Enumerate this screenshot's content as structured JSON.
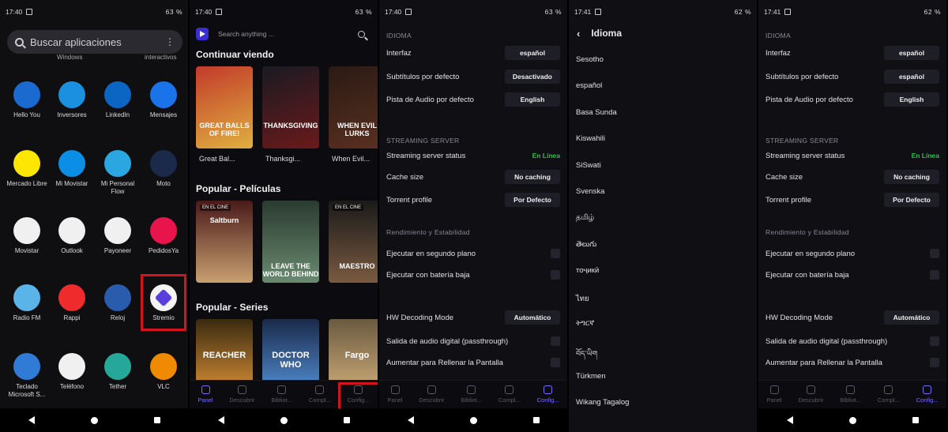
{
  "panel1": {
    "status": {
      "time": "17:40",
      "battery": "63 %"
    },
    "search_placeholder": "Buscar aplicaciones",
    "cut_left": "Windows",
    "cut_right": "interactivos",
    "apps": [
      {
        "label": "Hello You",
        "icon": "hello-you-icon",
        "color": "#1a6ad0"
      },
      {
        "label": "Inversores",
        "icon": "inversores-icon",
        "color": "#1b8fe0"
      },
      {
        "label": "LinkedIn",
        "icon": "linkedin-icon",
        "color": "#0a66c2"
      },
      {
        "label": "Mensajes",
        "icon": "messages-icon",
        "color": "#1a73e8"
      },
      {
        "label": "Mercado Libre",
        "icon": "mercadolibre-icon",
        "color": "#ffe600"
      },
      {
        "label": "Mi Movistar",
        "icon": "movistar-icon",
        "color": "#0b8fe6"
      },
      {
        "label": "Mi Personal Flow",
        "icon": "personal-flow-icon",
        "color": "#2aa7e0"
      },
      {
        "label": "Moto",
        "icon": "moto-icon",
        "color": "#1b2a4a"
      },
      {
        "label": "Movistar",
        "icon": "sim-icon",
        "color": "#f0f0f0"
      },
      {
        "label": "Outlook",
        "icon": "outlook-icon",
        "color": "#f0f0f0"
      },
      {
        "label": "Payoneer",
        "icon": "payoneer-icon",
        "color": "#f0f0f0"
      },
      {
        "label": "PedidosYa",
        "icon": "pedidosya-icon",
        "color": "#e8144c"
      },
      {
        "label": "Radio FM",
        "icon": "radio-icon",
        "color": "#5ab4e8"
      },
      {
        "label": "Rappi",
        "icon": "rappi-icon",
        "color": "#f02b2b"
      },
      {
        "label": "Reloj",
        "icon": "clock-icon",
        "color": "#2a5cae"
      },
      {
        "label": "Stremio",
        "icon": "stremio-icon",
        "color": "#f4f4f4"
      },
      {
        "label": "Teclado Microsoft S...",
        "icon": "keyboard-icon",
        "color": "#2f7bd6"
      },
      {
        "label": "Teléfono",
        "icon": "phone-icon",
        "color": "#f0f0f0"
      },
      {
        "label": "Tether",
        "icon": "tether-icon",
        "color": "#25a89a"
      },
      {
        "label": "VLC",
        "icon": "vlc-icon",
        "color": "#f08a00"
      }
    ]
  },
  "panel2": {
    "status": {
      "time": "17:40",
      "battery": "63 %"
    },
    "search_placeholder": "Search anything ...",
    "sections": [
      "Continuar viendo",
      "Popular - Películas",
      "Popular - Series"
    ],
    "continue": [
      {
        "title": "Great Bal...",
        "art": "GREAT BALLS OF FIRE!"
      },
      {
        "title": "Thanksgi...",
        "art": "THANKSGIVING"
      },
      {
        "title": "When Evil...",
        "art": "WHEN EVIL LURKS"
      }
    ],
    "movies": [
      {
        "badge": "EN EL CINE",
        "art": "Saltburn"
      },
      {
        "badge": "",
        "art": "LEAVE THE WORLD BEHIND"
      },
      {
        "badge": "EN EL CINE",
        "art": "MAESTRO"
      }
    ],
    "series": [
      {
        "art": "REACHER"
      },
      {
        "art": "DOCTOR WHO"
      },
      {
        "art": "Fargo"
      }
    ],
    "tabs": [
      "Panel",
      "Descubrir",
      "Bibliot...",
      "Compl...",
      "Config..."
    ]
  },
  "panel3": {
    "status": {
      "time": "17:40",
      "battery": "63 %"
    },
    "idioma": "IDIOMA",
    "interfaz": {
      "label": "Interfaz",
      "value": "español"
    },
    "subtitulos": {
      "label": "Subtítulos por defecto",
      "value": "Desactivado"
    },
    "audio": {
      "label": "Pista de Audio por defecto",
      "value": "English"
    },
    "streaming": "STREAMING SERVER",
    "server_status": {
      "label": "Streaming server status",
      "value": "En Línea"
    },
    "cache": {
      "label": "Cache size",
      "value": "No caching"
    },
    "torrent": {
      "label": "Torrent profile",
      "value": "Por Defecto"
    },
    "rendimiento": "Rendimiento y Estabilidad",
    "bg": "Ejecutar en segundo plano",
    "lowbat": "Ejecutar con batería baja",
    "hw": {
      "label": "HW Decoding Mode",
      "value": "Automático"
    },
    "passthrough": "Salida de audio digital (passthrough)",
    "fill": "Aumentar para Rellenar la Pantalla",
    "tabs": [
      "Panel",
      "Descubrir",
      "Bibliot...",
      "Compl...",
      "Config..."
    ]
  },
  "panel4": {
    "status": {
      "time": "17:41",
      "battery": "62 %"
    },
    "title": "Idioma",
    "languages": [
      "Sesotho",
      "español",
      "Basa Sunda",
      "Kiswahili",
      "SiSwati",
      "Svenska",
      "தமிழ்",
      "తెలుగు",
      "тоҷикӣ",
      "ไทย",
      "ትግርኛ",
      "བོད་ཡིག",
      "Türkmen",
      "Wikang Tagalog"
    ]
  },
  "panel5": {
    "status": {
      "time": "17:41",
      "battery": "62 %"
    },
    "idioma": "IDIOMA",
    "interfaz": {
      "label": "Interfaz",
      "value": "español"
    },
    "subtitulos": {
      "label": "Subtítulos por defecto",
      "value": "español"
    },
    "audio": {
      "label": "Pista de Audio por defecto",
      "value": "English"
    },
    "streaming": "STREAMING SERVER",
    "server_status": {
      "label": "Streaming server status",
      "value": "En Línea"
    },
    "cache": {
      "label": "Cache size",
      "value": "No caching"
    },
    "torrent": {
      "label": "Torrent profile",
      "value": "Por Defecto"
    },
    "rendimiento": "Rendimiento y Estabilidad",
    "bg": "Ejecutar en segundo plano",
    "lowbat": "Ejecutar con batería baja",
    "hw": {
      "label": "HW Decoding Mode",
      "value": "Automático"
    },
    "passthrough": "Salida de audio digital (passthrough)",
    "fill": "Aumentar para Rellenar la Pantalla",
    "tabs": [
      "Panel",
      "Descubrir",
      "Bibliot...",
      "Compl...",
      "Config..."
    ]
  }
}
